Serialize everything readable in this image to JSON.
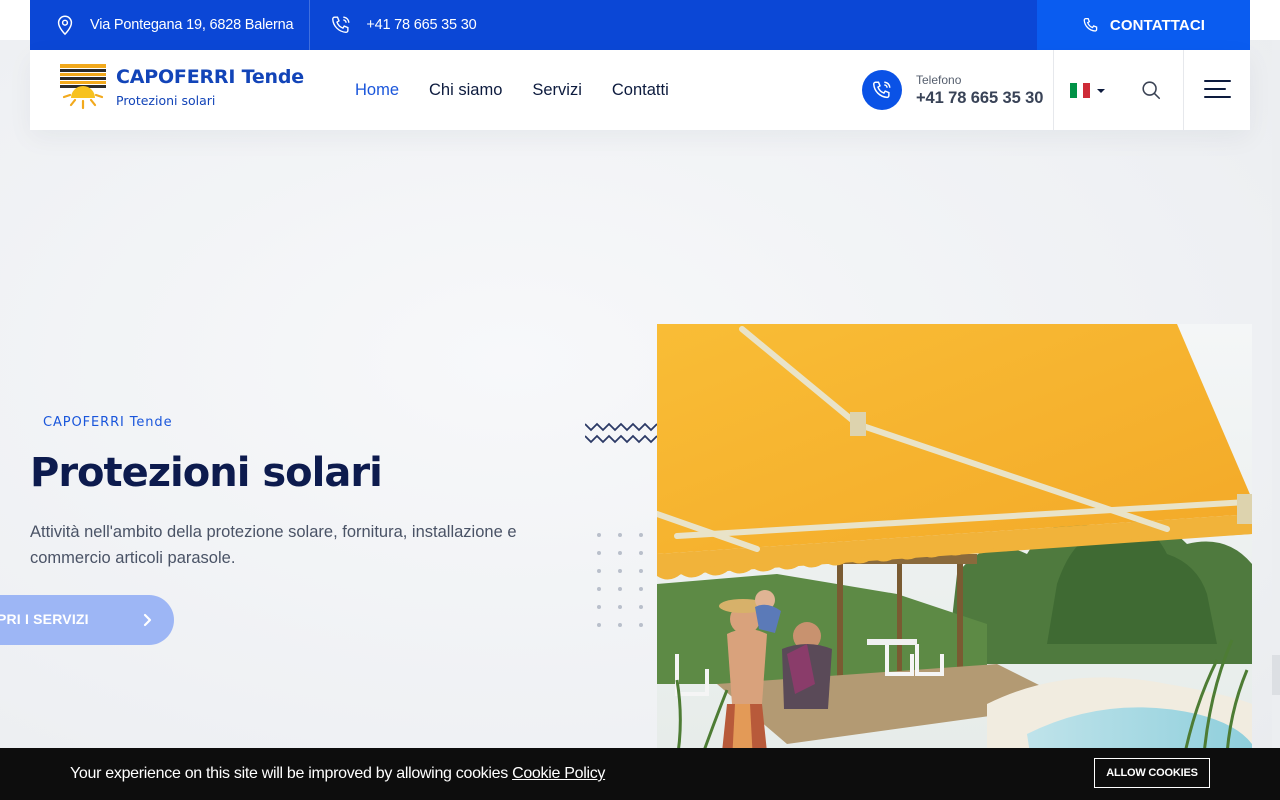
{
  "topbar": {
    "address": "Via Pontegana 19, 6828 Balerna",
    "phone": "+41 78 665 35 30",
    "contact_label": "CONTATTACI",
    "address_icon": "map-pin-icon",
    "phone_icon": "phone-icon"
  },
  "header": {
    "logo_title": "CAPOFERRI Tende",
    "logo_subtitle": "Protezioni solari",
    "nav": [
      {
        "label": "Home",
        "active": true
      },
      {
        "label": "Chi siamo",
        "active": false
      },
      {
        "label": "Servizi",
        "active": false
      },
      {
        "label": "Contatti",
        "active": false
      }
    ],
    "phone_label": "Telefono",
    "phone_number": "+41 78 665 35 30",
    "language": "Italiano",
    "language_icon": "italy-flag-icon",
    "search_icon": "search-icon",
    "menu_icon": "hamburger-menu-icon"
  },
  "hero": {
    "eyebrow": "CAPOFERRI Tende",
    "title": "Protezioni solari",
    "description": "Attività nell'ambito della protezione solare, fornitura, installazione e commercio articoli parasole.",
    "button_label": "SCOPRI I SERVIZI",
    "image_alt": "Yellow awning over a garden terrace with a family by a pool"
  },
  "cookie": {
    "message": "Your experience on this site will be improved by allowing cookies",
    "link": "Cookie Policy",
    "button": "ALLOW COOKIES"
  },
  "colors": {
    "brand_blue": "#0b47d6",
    "accent_blue": "#0a5cf0",
    "heading": "#0d1b4e",
    "awning_yellow": "#f7b531"
  }
}
